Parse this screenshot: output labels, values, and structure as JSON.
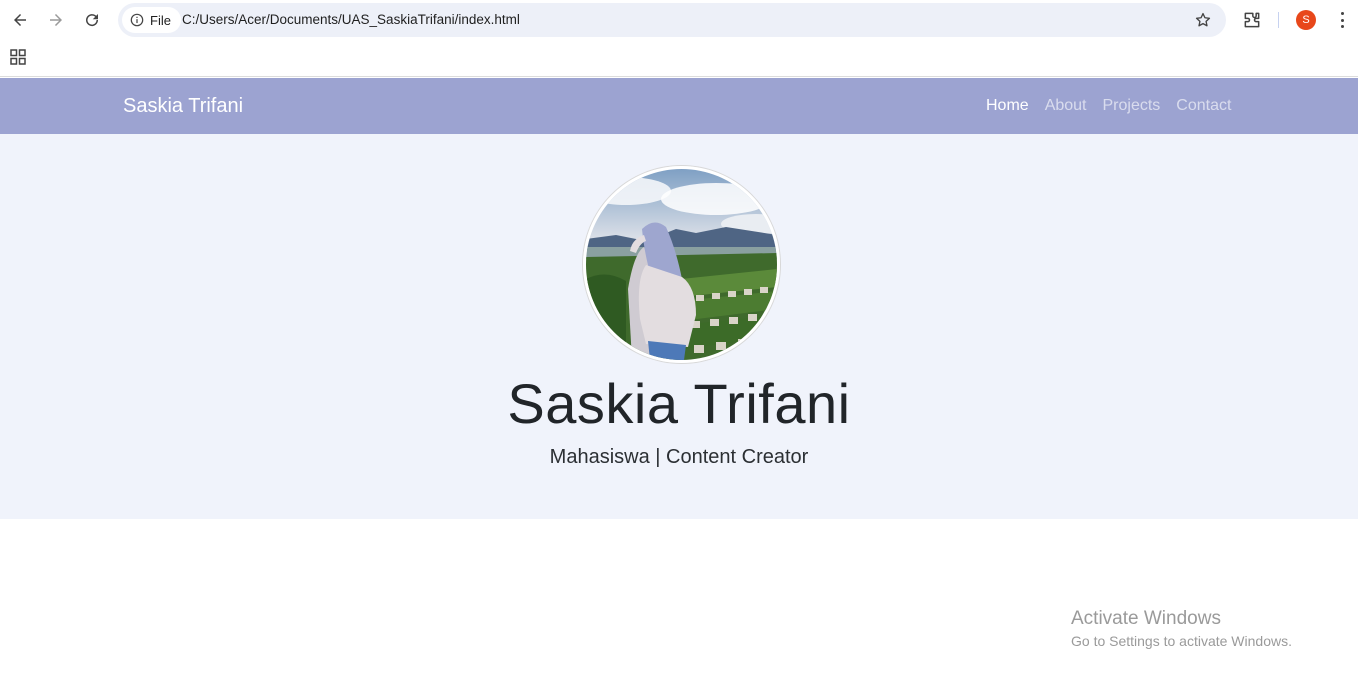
{
  "browser": {
    "file_chip_label": "File",
    "url": "C:/Users/Acer/Documents/UAS_SaskiaTrifani/index.html",
    "profile_initial": "S",
    "accent_color": "#e8471a"
  },
  "site": {
    "brand": "Saskia Trifani",
    "nav": [
      {
        "label": "Home",
        "active": true
      },
      {
        "label": "About",
        "active": false
      },
      {
        "label": "Projects",
        "active": false
      },
      {
        "label": "Contact",
        "active": false
      }
    ],
    "navbar_color": "#9ca3d1",
    "hero": {
      "name": "Saskia Trifani",
      "subtitle": "Mahasiswa | Content Creator",
      "background": "#f0f3fb"
    }
  },
  "os": {
    "activate_title": "Activate Windows",
    "activate_sub": "Go to Settings to activate Windows."
  }
}
